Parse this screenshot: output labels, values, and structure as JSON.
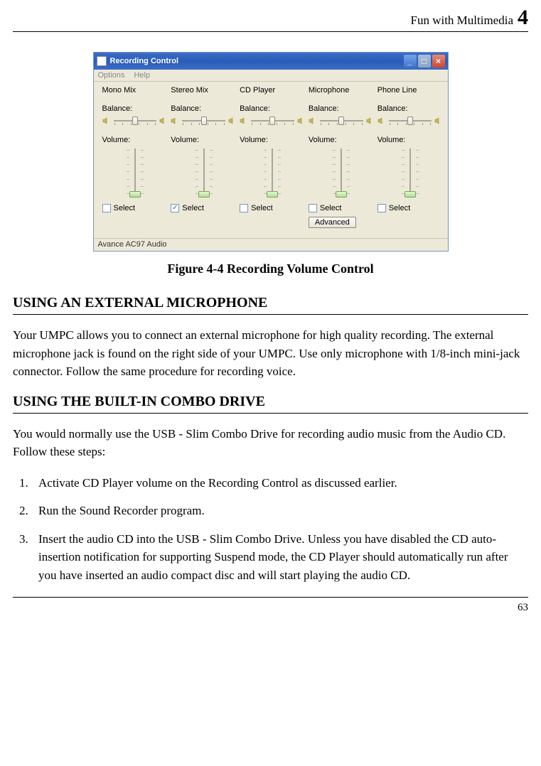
{
  "header": {
    "label": "Fun with Multimedia",
    "chapter": "4"
  },
  "window": {
    "title": "Recording Control",
    "menu": {
      "options": "Options",
      "help": "Help"
    },
    "channels": [
      {
        "name": "Mono Mix",
        "balance": "Balance:",
        "volume": "Volume:",
        "select": "Select",
        "checked": false,
        "thumb_pct": 88,
        "advanced": false
      },
      {
        "name": "Stereo Mix",
        "balance": "Balance:",
        "volume": "Volume:",
        "select": "Select",
        "checked": true,
        "thumb_pct": 88,
        "advanced": false
      },
      {
        "name": "CD Player",
        "balance": "Balance:",
        "volume": "Volume:",
        "select": "Select",
        "checked": false,
        "thumb_pct": 88,
        "advanced": false
      },
      {
        "name": "Microphone",
        "balance": "Balance:",
        "volume": "Volume:",
        "select": "Select",
        "checked": false,
        "thumb_pct": 88,
        "advanced": true,
        "advanced_label": "Advanced"
      },
      {
        "name": "Phone Line",
        "balance": "Balance:",
        "volume": "Volume:",
        "select": "Select",
        "checked": false,
        "thumb_pct": 88,
        "advanced": false
      }
    ],
    "status": "Avance AC97 Audio"
  },
  "figure_caption": "Figure 4-4 Recording Volume Control",
  "section1": {
    "heading": "USING AN EXTERNAL MICROPHONE",
    "body": "Your UMPC allows you to connect an external microphone for high quality recording. The external microphone jack is found on the right side of your UMPC. Use only microphone with 1/8-inch mini-jack connector. Follow the same procedure for recording voice."
  },
  "section2": {
    "heading": "USING THE BUILT-IN COMBO DRIVE",
    "intro": "You would normally use the USB - Slim Combo Drive for recording audio music from the Audio CD. Follow these steps:",
    "steps": [
      "Activate CD Player volume on the Recording Control as discussed earlier.",
      "Run the Sound Recorder program.",
      "Insert the audio CD into the USB - Slim Combo Drive. Unless you have disabled the CD auto-insertion notification for supporting Suspend mode, the CD Player should automatically run after you have inserted an audio compact disc and will start playing the audio CD."
    ]
  },
  "page_number": "63"
}
